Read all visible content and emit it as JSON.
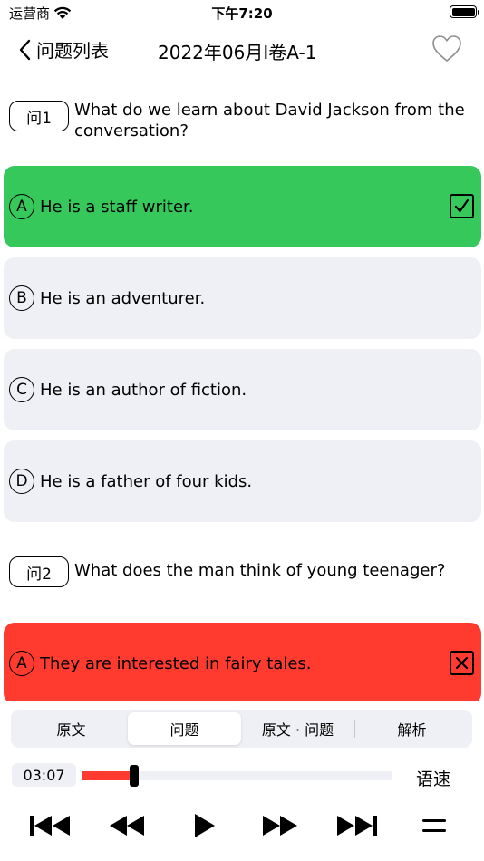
{
  "status_bar": {
    "carrier": "运营商",
    "time": "下午7:20"
  },
  "nav": {
    "back_label": "问题列表",
    "title": "2022年06月I卷A-1"
  },
  "questions": [
    {
      "badge": "问1",
      "text": "What do we learn about David Jackson from the conversation?",
      "options": [
        {
          "letter": "A",
          "text": "He is a staff writer.",
          "state": "correct"
        },
        {
          "letter": "B",
          "text": "He is an adventurer.",
          "state": "none"
        },
        {
          "letter": "C",
          "text": "He is an author of fiction.",
          "state": "none"
        },
        {
          "letter": "D",
          "text": "He is a father of four kids.",
          "state": "none"
        }
      ]
    },
    {
      "badge": "问2",
      "text": "What does the man think of young teenager?",
      "options": [
        {
          "letter": "A",
          "text": "They are interested in fairy tales.",
          "state": "wrong"
        }
      ]
    }
  ],
  "tabs": [
    {
      "label": "原文",
      "active": false
    },
    {
      "label": "问题",
      "active": true
    },
    {
      "label": "原文 · 问题",
      "active": false
    },
    {
      "label": "解析",
      "active": false
    }
  ],
  "player": {
    "elapsed": "03:07",
    "progress": 0.16,
    "speed_label": "语速"
  },
  "colors": {
    "correct": "#36c85a",
    "wrong": "#ff3b30",
    "option_bg": "#eff0f5",
    "progress": "#ff3b30"
  },
  "icons": {
    "back": "chevron-left-icon",
    "favorite": "heart-outline-icon",
    "correct_mark": "checkbox-checked-icon",
    "wrong_mark": "checkbox-x-icon",
    "controls": [
      "skip-to-start-icon",
      "rewind-icon",
      "play-icon",
      "fast-forward-icon",
      "skip-to-end-icon",
      "menu-icon"
    ]
  }
}
